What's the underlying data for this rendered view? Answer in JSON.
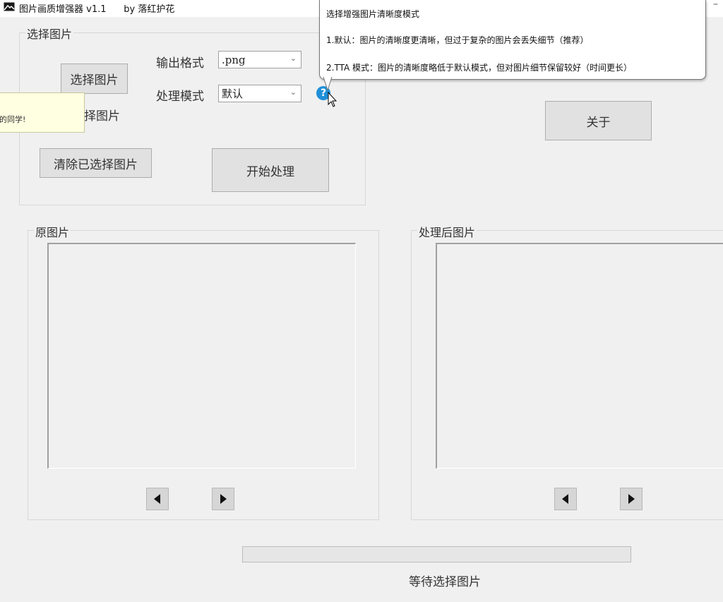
{
  "window": {
    "title": "图片画质增强器 v1.1      by 落红护花"
  },
  "select_group": {
    "legend": "选择图片",
    "select_button": "选择图片",
    "selected_label": "择图片",
    "clear_button": "清除已选择图片",
    "output_format_label": "输出格式",
    "output_format_value": ".png",
    "process_mode_label": "处理模式",
    "process_mode_value": "默认",
    "start_button": "开始处理"
  },
  "about_button": "关于",
  "tooltip": {
    "title": "选择增强图片清晰度模式",
    "line1": "1.默认：图片的清晰度更清晰，但过于复杂的图片会丢失细节（推荐）",
    "line2": "2.TTA 模式：图片的清晰度略低于默认模式，但对图片细节保留较好（时间更长）"
  },
  "side_note": "的同学!",
  "original_panel": {
    "legend": "原图片"
  },
  "processed_panel": {
    "legend": "处理后图片"
  },
  "progress": {
    "value": 0
  },
  "status_text": "等待选择图片",
  "icons": {
    "help": "question-circle-icon",
    "prev": "triangle-left-icon",
    "next": "triangle-right-icon",
    "app": "image-icon"
  },
  "colors": {
    "help_icon": "#1f8fd9",
    "progress_fill": "#06b025"
  }
}
